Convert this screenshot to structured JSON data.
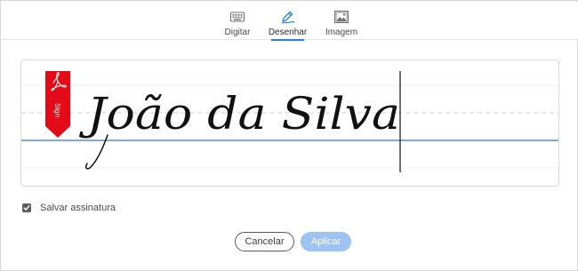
{
  "tabs": [
    {
      "id": "type",
      "label": "Digitar",
      "icon": "keyboard-icon",
      "active": false
    },
    {
      "id": "draw",
      "label": "Desenhar",
      "icon": "pen-icon",
      "active": true
    },
    {
      "id": "image",
      "label": "Imagem",
      "icon": "image-icon",
      "active": false
    }
  ],
  "signature": {
    "text": "João da Silva",
    "badge_label": "Sign",
    "badge_icon": "acrobat-icon"
  },
  "save": {
    "label": "Salvar assinatura",
    "checked": true
  },
  "buttons": {
    "cancel": "Cancelar",
    "apply": "Aplicar"
  },
  "colors": {
    "accent": "#2680eb",
    "badge": "#e30b17",
    "apply_disabled": "#9cc3f3",
    "baseline": "#2a7bd0"
  }
}
